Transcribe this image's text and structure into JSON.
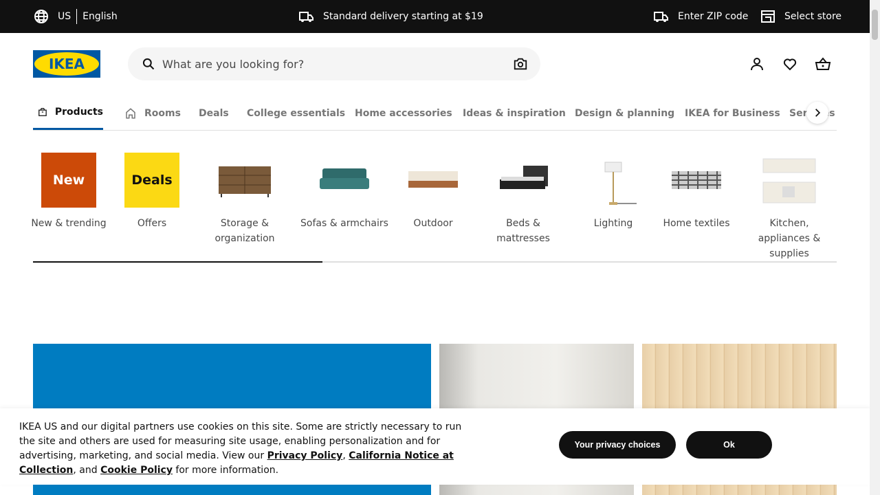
{
  "topbar": {
    "country": "US",
    "language": "English",
    "delivery": "Standard delivery starting at $19",
    "zip": "Enter ZIP code",
    "store": "Select store"
  },
  "header": {
    "logo_text": "IKEA",
    "search_placeholder": "What are you looking for?"
  },
  "nav": {
    "tabs": [
      "Products",
      "Rooms",
      "Deals",
      "College essentials",
      "Home accessories",
      "Ideas & inspiration",
      "Design & planning",
      "IKEA for Business",
      "Services &"
    ]
  },
  "categories": [
    {
      "label": "New & trending",
      "tile": "New",
      "color": "#cc4a08"
    },
    {
      "label": "Offers",
      "tile": "Deals",
      "color": "#fbd914"
    },
    {
      "label": "Storage & organization"
    },
    {
      "label": "Sofas & armchairs"
    },
    {
      "label": "Outdoor"
    },
    {
      "label": "Beds & mattresses"
    },
    {
      "label": "Lighting"
    },
    {
      "label": "Home textiles"
    },
    {
      "label": "Kitchen, appliances & supplies"
    }
  ],
  "carousel_progress": 0.36,
  "cookie": {
    "text1": "IKEA US and our digital partners use cookies on this site. Some are strictly necessary to run the site and others are used for measuring site usage, enabling personalization and for advertising, marketing, and social media. View our ",
    "privacy": "Privacy Policy",
    "sep1": ", ",
    "california": "California Notice at Collection",
    "sep2": ", and ",
    "cookie_policy": "Cookie Policy",
    "text2": " for more information.",
    "privacy_choices": "Your privacy choices",
    "ok": "Ok"
  },
  "colors": {
    "brand_blue": "#0058a3",
    "brand_yellow": "#ffdb00",
    "promo_blue": "#007cc1"
  }
}
